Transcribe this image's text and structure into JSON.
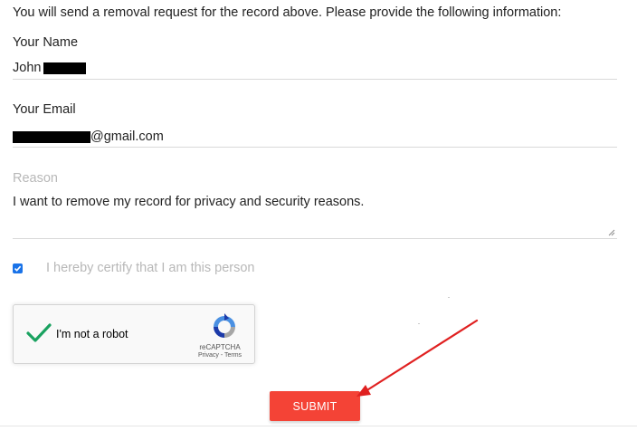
{
  "intro_text": "You will send a removal request for the record above. Please provide the following information:",
  "name_field": {
    "label": "Your Name",
    "value": "John"
  },
  "email_field": {
    "label": "Your Email",
    "value": "@gmail.com"
  },
  "reason_field": {
    "label": "Reason",
    "value": "I want to remove my record for privacy and security reasons."
  },
  "certify": {
    "checked": true,
    "label": "I hereby certify that I am this person"
  },
  "recaptcha": {
    "label": "I'm not a robot",
    "brand": "reCAPTCHA",
    "terms": "Privacy - Terms",
    "status": "verified"
  },
  "submit_label": "SUBMIT",
  "colors": {
    "accent_red": "#f44336",
    "checkbox_blue": "#1a73e8",
    "recaptcha_check_green": "#1aa260",
    "annotation_arrow": "#e02020"
  },
  "icons": {
    "checkbox": "checkmark-icon",
    "recaptcha_check": "checkmark-icon",
    "recaptcha_logo": "recaptcha-logo-icon",
    "annotation": "red-arrow-icon"
  }
}
